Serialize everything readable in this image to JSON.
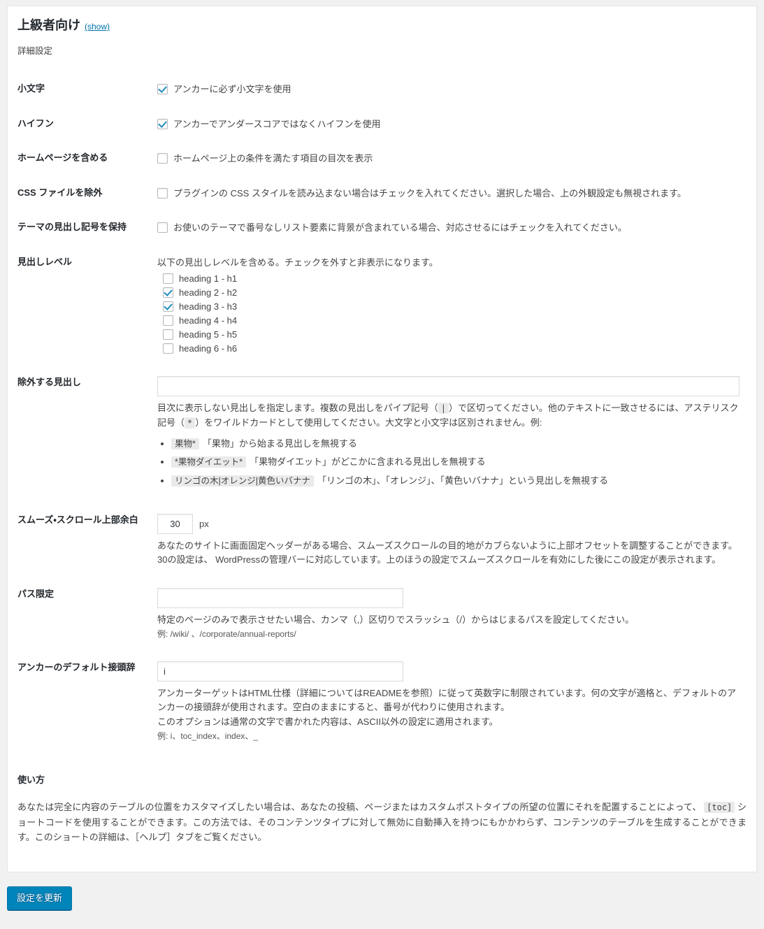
{
  "header": {
    "title": "上級者向け",
    "toggle_label": "(show)",
    "subtitle": "詳細設定"
  },
  "rows": {
    "lowercase": {
      "label": "小文字",
      "checkbox_text": "アンカーに必ず小文字を使用",
      "checked": true
    },
    "hyphenate": {
      "label": "ハイフン",
      "checkbox_text": "アンカーでアンダースコアではなくハイフンを使用",
      "checked": true
    },
    "include_homepage": {
      "label": "ホームページを含める",
      "checkbox_text": "ホームページ上の条件を満たす項目の目次を表示",
      "checked": false
    },
    "exclude_css": {
      "label": "CSS ファイルを除外",
      "checkbox_text": "プラグインの CSS スタイルを読み込まない場合はチェックを入れてください。選択した場合、上の外観設定も無視されます。",
      "checked": false
    },
    "preserve_theme_bullets": {
      "label": "テーマの見出し記号を保持",
      "checkbox_text": "お使いのテーマで番号なしリスト要素に背景が含まれている場合、対応させるにはチェックを入れてください。",
      "checked": false
    },
    "heading_levels": {
      "label": "見出しレベル",
      "intro": "以下の見出しレベルを含める。チェックを外すと非表示になります。",
      "items": [
        {
          "label": "heading 1 - h1",
          "checked": false
        },
        {
          "label": "heading 2 - h2",
          "checked": true
        },
        {
          "label": "heading 3 - h3",
          "checked": true
        },
        {
          "label": "heading 4 - h4",
          "checked": false
        },
        {
          "label": "heading 5 - h5",
          "checked": false
        },
        {
          "label": "heading 6 - h6",
          "checked": false
        }
      ]
    },
    "exclude_headings": {
      "label": "除外する見出し",
      "value": "",
      "desc": "目次に表示しない見出しを指定します。複数の見出しをパイプ記号（",
      "desc_code_pipe": "|",
      "desc_2": "）で区切ってください。他のテキストに一致させるには、アステリスク記号（",
      "desc_code_star": "*",
      "desc_3": "）をワイルドカードとして使用してください。大文字と小文字は区別されません。例:",
      "examples": [
        {
          "code": "果物*",
          "text": "「果物」から始まる見出しを無視する"
        },
        {
          "code": "*果物ダイエット*",
          "text": "「果物ダイエット」がどこかに含まれる見出しを無視する"
        },
        {
          "code": "リンゴの木|オレンジ|黄色いバナナ",
          "text": "「リンゴの木」、「オレンジ」、「黄色いバナナ」という見出しを無視する"
        }
      ]
    },
    "smooth_scroll_offset": {
      "label": "スムーズ・スクロール上部余白",
      "value": "30",
      "unit": "px",
      "desc": "あなたのサイトに画面固定ヘッダーがある場合、スムーズスクロールの目的地がカブらないように上部オフセットを調整することができます。 30の設定は、 WordPressの管理バーに対応しています。上のほうの設定でスムーズスクロールを有効にした後にこの設定が表示されます。"
    },
    "restrict_path": {
      "label": "パス限定",
      "value": "",
      "desc": "特定のページのみで表示させたい場合、カンマ（,）区切りでスラッシュ（/）からはじまるパスを設定してください。",
      "example": "例: /wiki/ 、/corporate/annual-reports/"
    },
    "anchor_prefix": {
      "label": "アンカーのデフォルト接頭辞",
      "value": "i",
      "desc_1": "アンカーターゲットはHTML仕様（詳細についてはREADMEを参照）に従って英数字に制限されています。何の文字が適格と、デフォルトのアンカーの接頭辞が使用されます。空白のままにすると、番号が代わりに使用されます。",
      "desc_2": "このオプションは通常の文字で書かれた内容は、ASCII以外の設定に適用されます。",
      "example": "例: i、toc_index、index、_"
    }
  },
  "usage": {
    "title": "使い方",
    "body_1": "あなたは完全に内容のテーブルの位置をカスタマイズしたい場合は、あなたの投稿、ページまたはカスタムポストタイプの所望の位置にそれを配置することによって、",
    "shortcode": "[toc]",
    "body_2": "ショートコードを使用することができます。この方法では、そのコンテンツタイプに対して無効に自動挿入を持つにもかかわらず、コンテンツのテーブルを生成することができます。このショートの詳細は、［ヘルプ］タブをご覧ください。"
  },
  "submit": {
    "label": "設定を更新"
  },
  "colors": {
    "accent": "#0085ba",
    "link": "#0073aa",
    "checkmark": "#1e8cbe",
    "page_bg": "#f1f1f1",
    "panel_bg": "#ffffff",
    "code_bg": "#eaeaea"
  }
}
